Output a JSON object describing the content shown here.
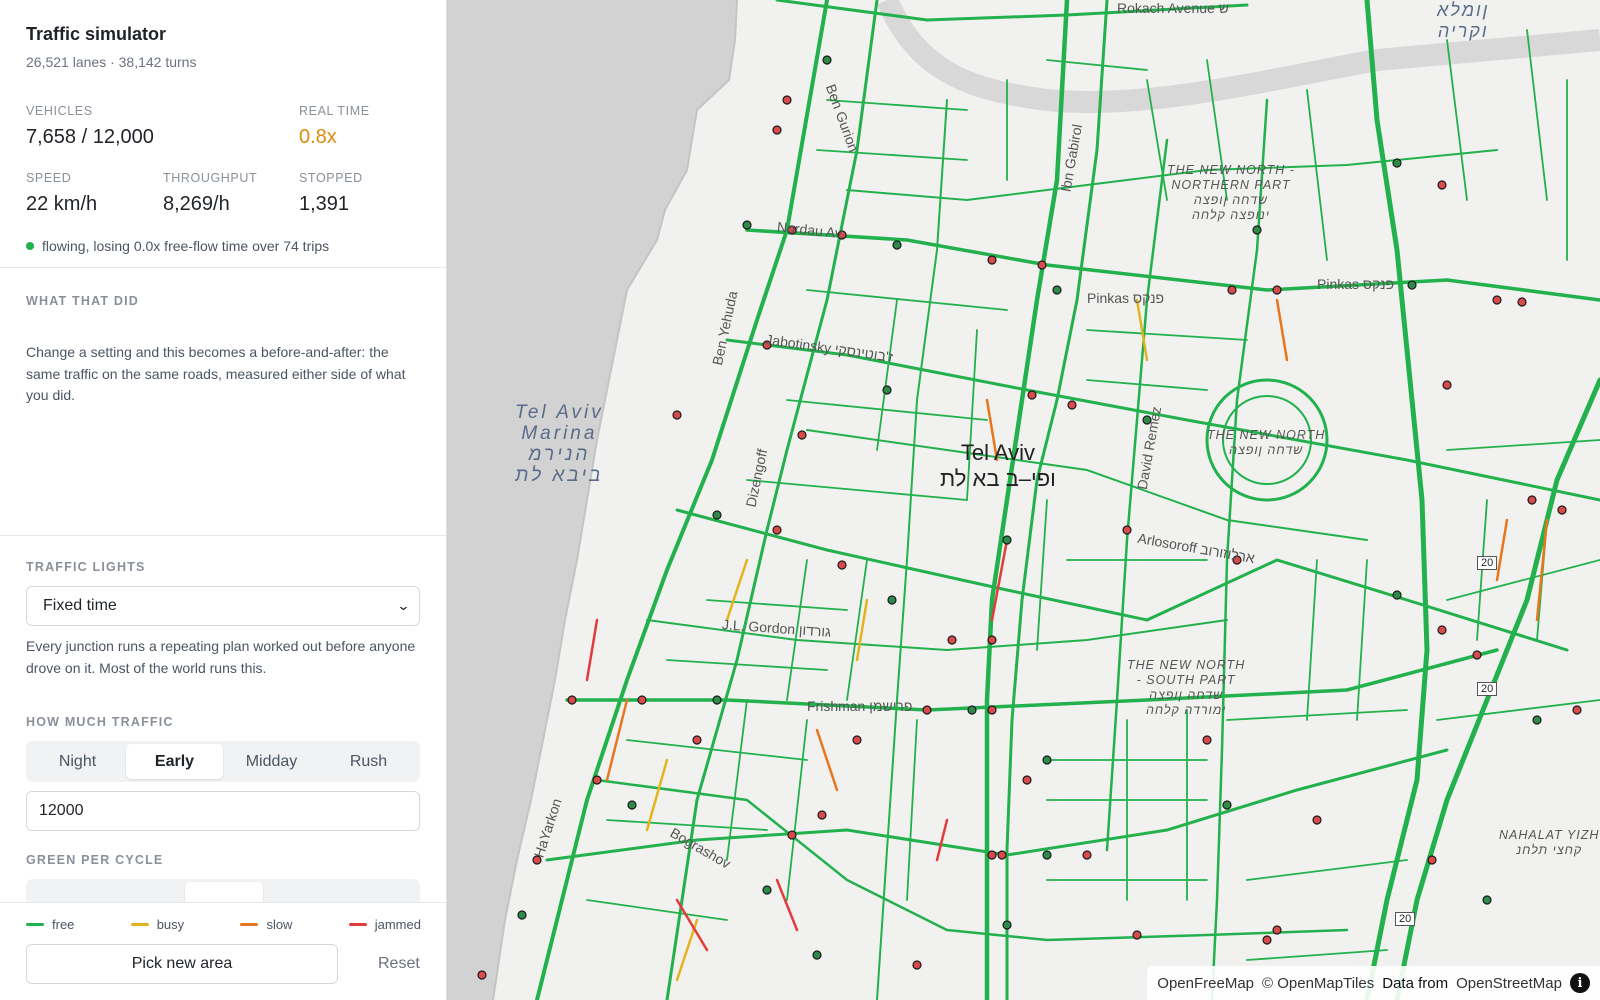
{
  "header": {
    "title": "Traffic simulator",
    "subtitle": "26,521 lanes · 38,142 turns"
  },
  "stats": {
    "vehicles_label": "VEHICLES",
    "vehicles_value": "7,658 / 12,000",
    "realtime_label": "REAL TIME",
    "realtime_value": "0.8x",
    "speed_label": "SPEED",
    "speed_value": "22 km/h",
    "throughput_label": "THROUGHPUT",
    "throughput_value": "8,269/h",
    "stopped_label": "STOPPED",
    "stopped_value": "1,391",
    "status_text": "flowing, losing 0.0x free-flow time over 74 trips",
    "status_color": "#22b14c",
    "accent_color": "#e08a0f"
  },
  "what": {
    "label": "WHAT THAT DID",
    "body": "Change a setting and this becomes a before-and-after: the same traffic on the same roads, measured either side of what you did."
  },
  "controls": {
    "lights_label": "TRAFFIC LIGHTS",
    "lights_selected": "Fixed time",
    "lights_hint": "Every junction runs a repeating plan worked out before anyone drove on it. Most of the world runs this.",
    "traffic_label": "HOW MUCH TRAFFIC",
    "traffic_options": [
      "Night",
      "Early",
      "Midday",
      "Rush"
    ],
    "traffic_selected": "Early",
    "traffic_value": "12000",
    "green_label": "GREEN PER CYCLE"
  },
  "legend": [
    {
      "label": "free",
      "color": "#22b14c"
    },
    {
      "label": "busy",
      "color": "#e3b320"
    },
    {
      "label": "slow",
      "color": "#e8761e"
    },
    {
      "label": "jammed",
      "color": "#e23b3b"
    }
  ],
  "footer": {
    "pick_label": "Pick new area",
    "reset_label": "Reset"
  },
  "map": {
    "city_en": "Tel Aviv",
    "city_he": "ופי–ב בא לת",
    "marina": [
      "Tel Aviv",
      "Marina",
      "הנירמ",
      "ביבא לת"
    ],
    "north_north": [
      "THE NEW NORTH -",
      "NORTHERN PART",
      "שדחה ןופצה",
      "ינופצה קלחה"
    ],
    "north_center": [
      "THE NEW NORTH",
      "שדחה ןופצה"
    ],
    "north_south": [
      "THE NEW NORTH",
      "- SOUTH PART",
      "שדחה ןופצה",
      "ימורדה קלחה"
    ],
    "nahalat": [
      "NAHALAT YIZH",
      "קחצי תלחנ"
    ],
    "top_right": [
      "ןומלא",
      "וקריה"
    ],
    "streets": {
      "rokach": "Rokach Avenue ש",
      "nordau": "Nordau Av.",
      "pinkas1": "Pinkas פנקס",
      "pinkas2": "Pinkas פנקס",
      "jabotinsky": "Jabotinsky ז'בוטינסקי",
      "gordon": "J.L. Gordon גורדון",
      "frishman": "Frishman פרישמן",
      "arlosoroff": "Arlosoroff ארלוזורוב",
      "bengurion": "Ben Gurion",
      "dizengoff": "Dizengoff",
      "yehuda": "Ben Yehuda",
      "hayarkon": "HaYarkon",
      "david": "David Remez",
      "bograshov": "Bograshov",
      "hamasger": "Ibn Gabirol"
    },
    "route_shields": [
      "20",
      "20",
      "20"
    ],
    "attribution": {
      "ofm": "OpenFreeMap",
      "omt": "© OpenMapTiles",
      "data": "Data from",
      "osm": "OpenStreetMap"
    }
  }
}
